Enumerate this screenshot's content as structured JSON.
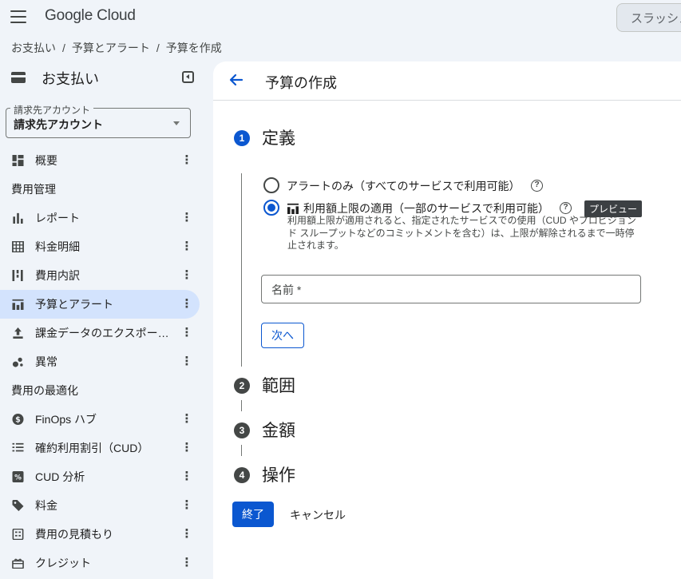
{
  "app": {
    "logo": "Google Cloud",
    "search_placeholder": "スラッシュ"
  },
  "breadcrumb": {
    "items": [
      "お支払い",
      "予算とアラート",
      "予算を作成"
    ],
    "separator": "/"
  },
  "sidebar": {
    "title": "お支払い",
    "account": {
      "label": "請求先アカウント",
      "value": "請求先アカウント"
    },
    "items": [
      {
        "label": "概要",
        "icon": "dashboard-icon"
      },
      {
        "section": "費用管理"
      },
      {
        "label": "レポート",
        "icon": "bar-chart-icon"
      },
      {
        "label": "料金明細",
        "icon": "table-icon"
      },
      {
        "label": "費用内訳",
        "icon": "breakdown-icon"
      },
      {
        "label": "予算とアラート",
        "icon": "budget-icon",
        "active": true
      },
      {
        "label": "課金データのエクスポー…",
        "icon": "export-icon"
      },
      {
        "label": "異常",
        "icon": "anomaly-icon"
      },
      {
        "section": "費用の最適化"
      },
      {
        "label": "FinOps ハブ",
        "icon": "dollar-icon"
      },
      {
        "label": "確約利用割引（CUD）",
        "icon": "list-icon"
      },
      {
        "label": "CUD 分析",
        "icon": "percent-icon"
      },
      {
        "label": "料金",
        "icon": "tag-icon"
      },
      {
        "label": "費用の見積もり",
        "icon": "calculator-icon"
      },
      {
        "label": "クレジット",
        "icon": "gift-icon"
      }
    ]
  },
  "main": {
    "title": "予算の作成",
    "steps": [
      {
        "number": "1",
        "title": "定義"
      },
      {
        "number": "2",
        "title": "範囲"
      },
      {
        "number": "3",
        "title": "金額"
      },
      {
        "number": "4",
        "title": "操作"
      }
    ],
    "options": {
      "alert_only": "アラートのみ（すべてのサービスで利用可能）",
      "cap": "利用額上限の適用（一部のサービスで利用可能）",
      "preview_badge": "プレビュー",
      "cap_desc": [
        "利用額上限が適用されると、指定されたサービスでの使用（CUD やプロビジョン",
        "ド スループットなどのコミットメントを含む）は、上限が解除されるまで一時停",
        "止されます。"
      ],
      "selected": "cap"
    },
    "name_placeholder": "名前 *",
    "next_label": "次へ",
    "finish_label": "終了",
    "cancel_label": "キャンセル",
    "accent_color": "#0b57d0"
  }
}
